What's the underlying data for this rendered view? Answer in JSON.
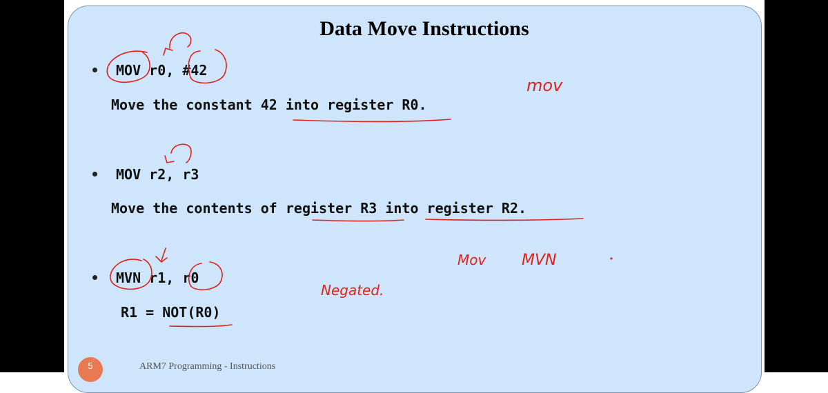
{
  "slide": {
    "title": "Data Move Instructions",
    "items": [
      {
        "code": "MOV r0, #42",
        "desc": "Move the constant 42 into register R0."
      },
      {
        "code": "MOV r2, r3",
        "desc": "Move the contents of register R3 into register R2."
      },
      {
        "code": "MVN r1, r0",
        "desc": "R1 = NOT(R0)"
      }
    ],
    "footer": "ARM7 Programming - Instructions",
    "page_number": "5"
  },
  "annotations": {
    "ink_color": "#e0201b",
    "notes": [
      "mov",
      "Mov",
      "MVN",
      "Negated."
    ]
  }
}
